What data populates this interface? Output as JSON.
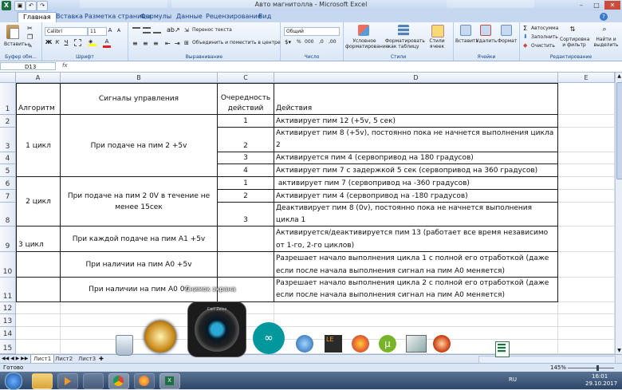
{
  "window": {
    "title": "Авто магнитолла - Microsoft Excel",
    "minimize": "–",
    "maximize": "□",
    "close": "✕"
  },
  "tabs": [
    "Главная",
    "Вставка",
    "Разметка страницы",
    "Формулы",
    "Данные",
    "Рецензирование",
    "Вид"
  ],
  "ribbon": {
    "paste": "Вставить",
    "clipboard_label": "Буфер обм...",
    "font": {
      "name": "Calibri",
      "size": "11",
      "bold": "Ж",
      "italic": "К",
      "underline": "Ч",
      "grow": "A",
      "shrink": "A",
      "fontcolor": "A",
      "label": "Шрифт"
    },
    "align": {
      "wrap": "Перенос текста",
      "merge": "Объединить и поместить в центре",
      "label": "Выравнивание"
    },
    "number": {
      "format": "Общий",
      "currency": "%",
      "thousands": "000",
      "label": "Число"
    },
    "styles": {
      "conditional": "Условное форматирование",
      "as_table": "Форматировать как таблицу",
      "cell_styles": "Стили ячеек",
      "label": "Стили"
    },
    "cells": {
      "insert": "Вставить",
      "delete": "Удалить",
      "format": "Формат",
      "label": "Ячейки"
    },
    "editing": {
      "autosum": "Автосумма",
      "fill": "Заполнить",
      "clear": "Очистить",
      "sort": "Сортировка и фильтр",
      "find": "Найти и выделить",
      "label": "Редактирование"
    }
  },
  "formula_bar": {
    "cell_ref": "D13",
    "fx": "fx",
    "content": ""
  },
  "columns": [
    "A",
    "B",
    "C",
    "D",
    "E"
  ],
  "rows": [
    {
      "n": "1",
      "a": "Алгоритм",
      "b": "Сигналы управления",
      "c": "Очередность действий",
      "d": "Действия"
    },
    {
      "n": "2",
      "c": "1",
      "d": "Активирует пим 12 (+5v, 5 сек)"
    },
    {
      "n": "3",
      "a": "1 цикл",
      "b": "При подаче на пим 2 +5v",
      "c": "2",
      "d": "Активирует пим 8 (+5v), постоянно пока не начнется выполнения цикла 2"
    },
    {
      "n": "4",
      "c": "3",
      "d": "Активируется пим 4 (сервопривод на 180 градусов)"
    },
    {
      "n": "5",
      "c": "4",
      "d": "Активирует пим 7 с задержкой 5 сек (сервопривод на 360 градусов)"
    },
    {
      "n": "6",
      "c": "1",
      "d": " активирует пим 7 (сервопривод на -360 градусов)"
    },
    {
      "n": "7",
      "a": "2 цикл",
      "b": "При подаче на пим 2 0V в течение не менее 15сек",
      "c": "2",
      "d": "Активирует пим 4 (сервопривод на -180 градусов)"
    },
    {
      "n": "8",
      "c": "3",
      "d": "Деактивирует пим 8 (0v), постоянно пока не начнется выполнения цикла 1"
    },
    {
      "n": "9",
      "a": "3 цикл",
      "b": "При каждой подаче на пим А1 +5v",
      "d": "Активируется/деактивируется пим 13 (работает все время независимо от 1-го, 2-го циклов)"
    },
    {
      "n": "10",
      "b": "При наличии на пим А0 +5v",
      "d": "Разрешает начало выполнения цикла 1 с полной его отработкой (даже если после начала выполнения сигнал на пим А0 меняется)"
    },
    {
      "n": "11",
      "b": "При наличии на пим А0 0v",
      "d": "Разрешает начало выполнения цикла 2 с полной его отработкой (даже если после начала выполнения сигнал на пим А0 меняется)"
    },
    {
      "n": "12"
    },
    {
      "n": "13"
    },
    {
      "n": "14"
    },
    {
      "n": "15"
    }
  ],
  "sheets": [
    "Лист1",
    "Лист2",
    "Лист3"
  ],
  "status": {
    "ready": "Готово",
    "zoom": "145%",
    "lang": "RU",
    "time": "16:01",
    "date": "29.10.2017"
  },
  "overlay": {
    "snip_label": "Снимок экрана",
    "camera_text": "Carl Zeiss"
  },
  "colors": {
    "excel_green": "#1d6f42",
    "ribbon_blue": "#15428b",
    "grid_border": "#1a1a1a"
  }
}
